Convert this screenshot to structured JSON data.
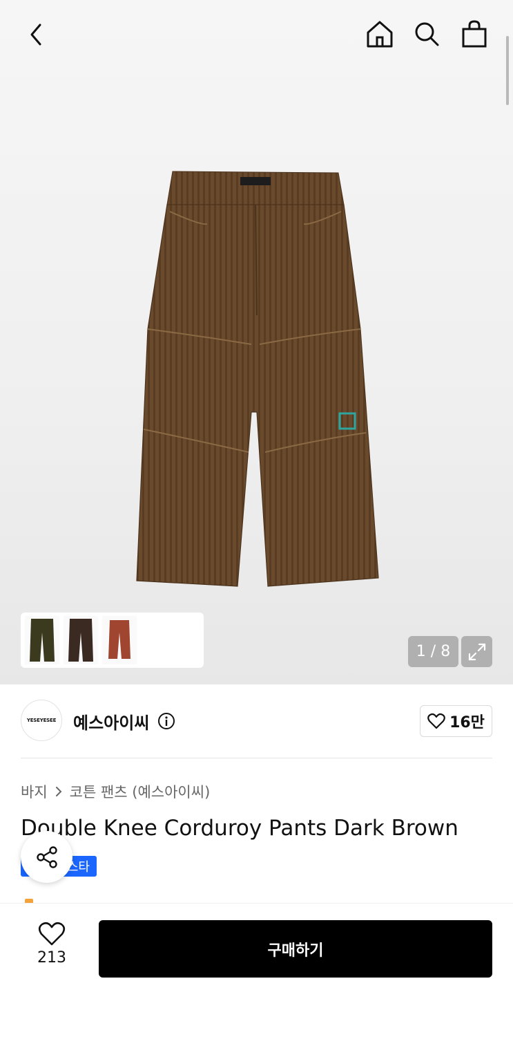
{
  "header": {
    "back_icon": "chevron-left-icon",
    "home_icon": "home-icon",
    "search_icon": "search-icon",
    "cart_icon": "shopping-bag-icon"
  },
  "gallery": {
    "counter": "1 / 8",
    "thumbnails": [
      {
        "color": "#3b3a1f"
      },
      {
        "color": "#3a2a22"
      },
      {
        "color": "#a0452f"
      }
    ]
  },
  "brand": {
    "logo_text": "YESEYESEE",
    "name": "예스아이씨",
    "likes": "16만"
  },
  "product": {
    "breadcrumb_category": "바지",
    "breadcrumb_sub": "코튼 팬츠 (예스아이씨)",
    "title": "Double Knee Corduroy Pants Dark Brown",
    "badge": "스타"
  },
  "bottom": {
    "wish_count": "213",
    "buy_label": "구매하기"
  },
  "colors": {
    "buy_button": "#000000",
    "badge": "#1a66ff"
  }
}
